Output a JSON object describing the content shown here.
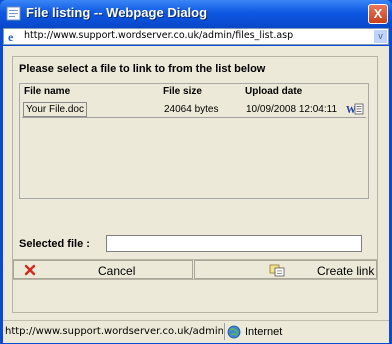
{
  "window": {
    "title": "File listing -- Webpage Dialog",
    "close_glyph": "X"
  },
  "address": {
    "url": "http://www.support.wordserver.co.uk/admin/files_list.asp",
    "dropdown_glyph": "v"
  },
  "main": {
    "prompt": "Please select a file to link to from the list below",
    "columns": [
      "File name",
      "File size",
      "Upload date"
    ],
    "files": [
      {
        "name": "Your File.doc",
        "size": "24064 bytes",
        "date": "10/09/2008 12:04:11",
        "icon": "word-doc-icon"
      }
    ],
    "selected_label": "Selected file :",
    "selected_value": ""
  },
  "buttons": {
    "cancel": "Cancel",
    "create": "Create link",
    "cancel_icon": "red-x-icon",
    "create_icon": "link-document-icon"
  },
  "status": {
    "url": "http://www.support.wordserver.co.uk/admin/files_lis",
    "zone": "Internet",
    "zone_icon": "globe-icon"
  }
}
